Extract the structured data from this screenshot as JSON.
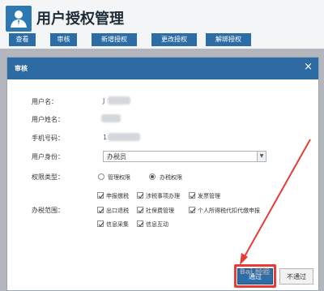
{
  "app": {
    "title": "用户授权管理"
  },
  "tabs": [
    "查看",
    "审核",
    "新增授权",
    "更改授权",
    "解绑授权"
  ],
  "dialog": {
    "title": "审核",
    "close_glyph": "×",
    "fields": {
      "username_label": "用户名：",
      "username_value": "J",
      "realname_label": "用户姓名：",
      "phone_label": "手机号码：",
      "phone_value": "1",
      "identity_label": "用户身份：",
      "identity_value": "办税员",
      "permtype_label": "权限类型：",
      "permtype_options": [
        "管理权限",
        "办税权限"
      ],
      "permtype_selected": "办税权限",
      "scope_label": "办税范围：",
      "scope_options": [
        "申报缴税",
        "涉税事项办理",
        "发票管理",
        "出口退税",
        "社保费管理",
        "个人所得税代扣代缴申报",
        "信息采集",
        "信息互动"
      ]
    },
    "buttons": {
      "pass": "通过",
      "reject": "不通过"
    }
  },
  "watermark": "Bai 经验",
  "colors": {
    "header_blue": "#2d6da6",
    "highlight_red": "#e83b36"
  }
}
